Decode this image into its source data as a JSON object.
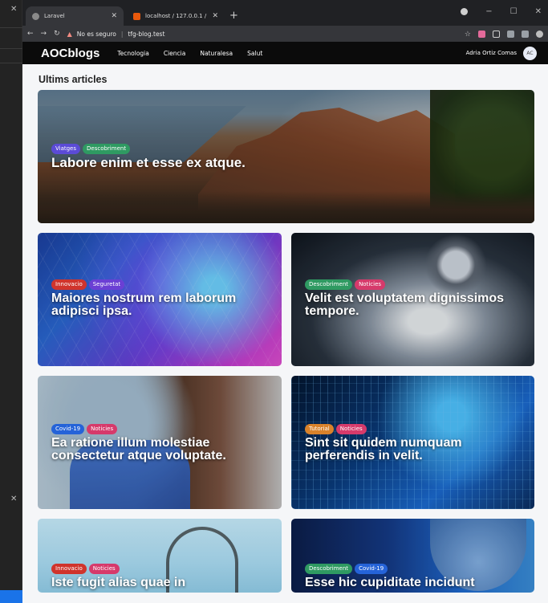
{
  "browser": {
    "tabs": [
      {
        "title": "Laravel",
        "active": true
      },
      {
        "title": "localhost / 127.0.0.1 / tfg_blog | ...",
        "active": false
      }
    ],
    "security_label": "No es seguro",
    "url": "tfg-blog.test"
  },
  "site": {
    "brand": "AOCblogs",
    "nav": [
      "Tecnologia",
      "Ciencia",
      "Naturalesa",
      "Salut"
    ],
    "user_name": "Adria Ortiz Comas",
    "avatar_initials": "AC"
  },
  "section_title": "Ultims articles",
  "featured": {
    "tags": [
      {
        "label": "Viatges",
        "color": "#5b4bd6"
      },
      {
        "label": "Descobriment",
        "color": "#2f9a62"
      }
    ],
    "title": "Labore enim et esse ex atque."
  },
  "articles": [
    {
      "tags": [
        {
          "label": "Innovacio",
          "color": "#d0342c"
        },
        {
          "label": "Seguretat",
          "color": "#6b3fd4"
        }
      ],
      "title": "Maiores nostrum rem laborum adipisci ipsa."
    },
    {
      "tags": [
        {
          "label": "Descobriment",
          "color": "#2f9a62"
        },
        {
          "label": "Noticies",
          "color": "#d63a6b"
        }
      ],
      "title": "Velit est voluptatem dignissimos tempore."
    },
    {
      "tags": [
        {
          "label": "Covid-19",
          "color": "#2563d8"
        },
        {
          "label": "Noticies",
          "color": "#d63a6b"
        }
      ],
      "title": "Ea ratione illum molestiae consectetur atque voluptate."
    },
    {
      "tags": [
        {
          "label": "Tutorial",
          "color": "#d9822b"
        },
        {
          "label": "Noticies",
          "color": "#d63a6b"
        }
      ],
      "title": "Sint sit quidem numquam perferendis in velit."
    },
    {
      "tags": [
        {
          "label": "Innovacio",
          "color": "#d0342c"
        },
        {
          "label": "Noticies",
          "color": "#d63a6b"
        }
      ],
      "title": "Iste fugit alias quae in"
    },
    {
      "tags": [
        {
          "label": "Descobriment",
          "color": "#2f9a62"
        },
        {
          "label": "Covid-19",
          "color": "#2563d8"
        }
      ],
      "title": "Esse hic cupiditate incidunt"
    }
  ]
}
